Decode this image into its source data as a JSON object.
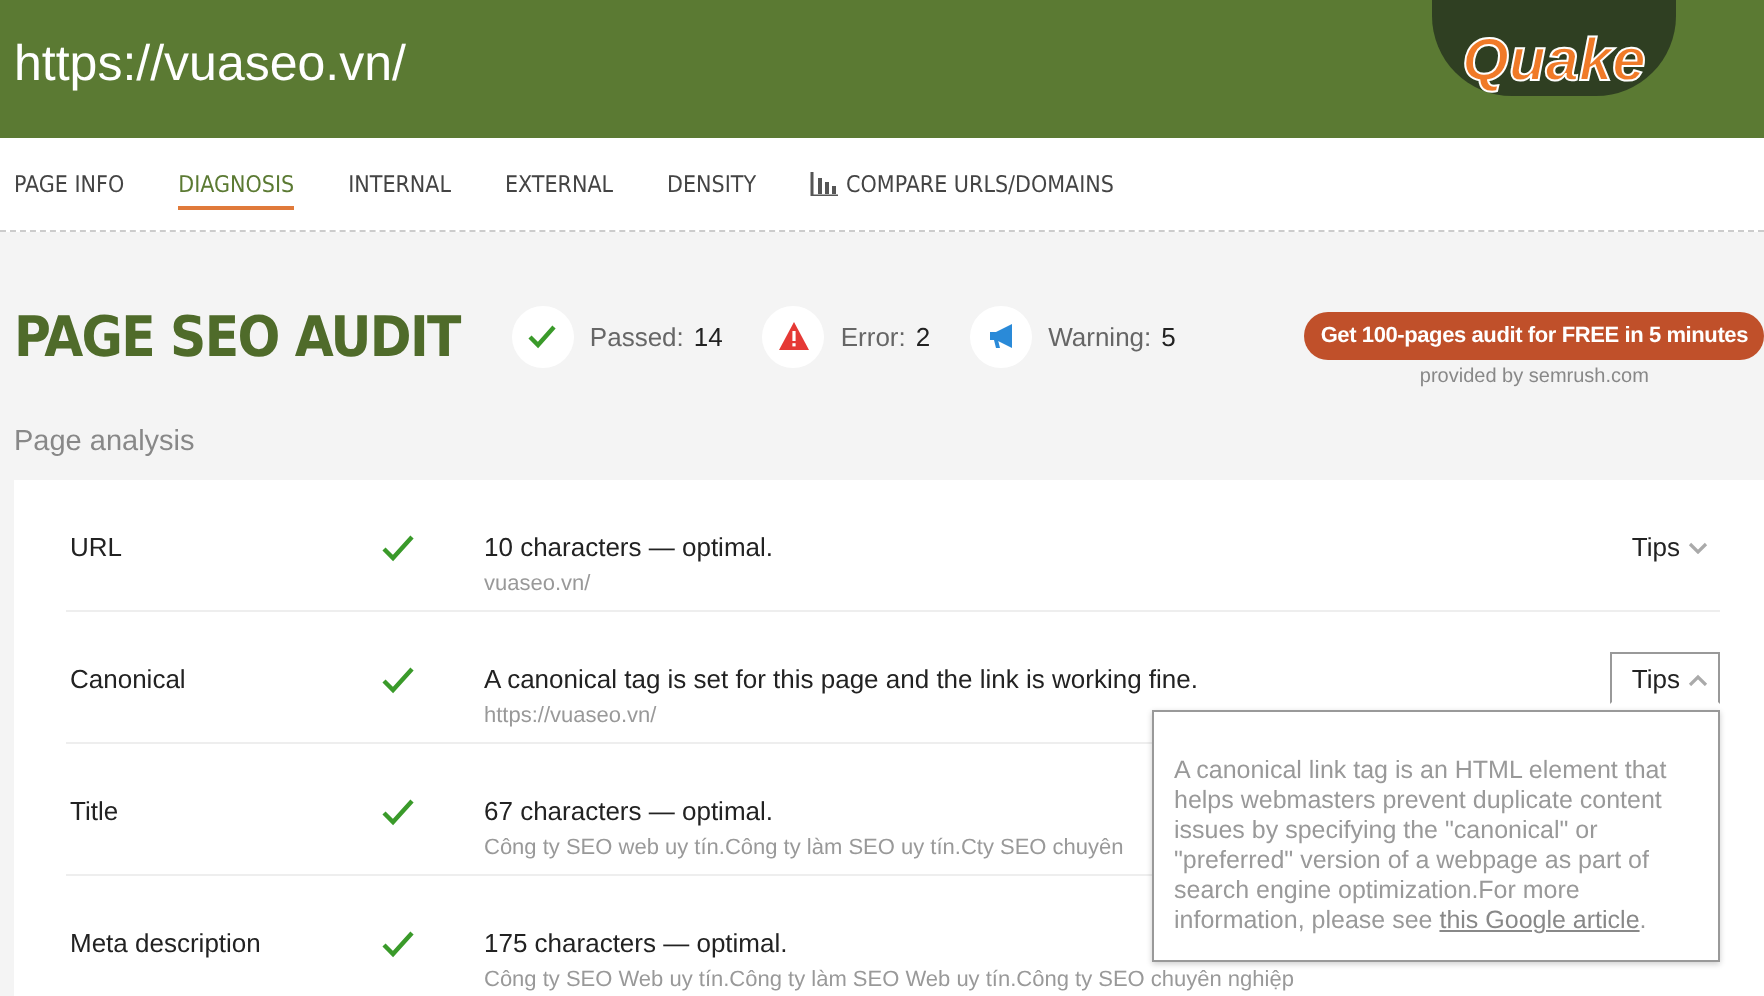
{
  "header": {
    "url": "https://vuaseo.vn/",
    "logo": "Quake"
  },
  "tabs": [
    {
      "label": "PAGE INFO",
      "selected": false,
      "icon": false
    },
    {
      "label": "DIAGNOSIS",
      "selected": true,
      "icon": false
    },
    {
      "label": "INTERNAL",
      "selected": false,
      "icon": false
    },
    {
      "label": "EXTERNAL",
      "selected": false,
      "icon": false
    },
    {
      "label": "DENSITY",
      "selected": false,
      "icon": false
    },
    {
      "label": "COMPARE URLS/DOMAINS",
      "selected": false,
      "icon": true
    }
  ],
  "audit": {
    "title": "PAGE SEO AUDIT",
    "stats": [
      {
        "kind": "passed",
        "label": "Passed:",
        "count": "14"
      },
      {
        "kind": "error",
        "label": "Error:",
        "count": "2"
      },
      {
        "kind": "warning",
        "label": "Warning:",
        "count": "5"
      }
    ],
    "promo_button": "Get 100-pages audit for FREE in 5 minutes",
    "provided_by": "provided by  semrush.com"
  },
  "section_title": "Page analysis",
  "rows": [
    {
      "name": "URL",
      "passed": true,
      "result": "10 characters — optimal.",
      "detail": "vuaseo.vn/",
      "tips": "Tips",
      "expanded": false
    },
    {
      "name": "Canonical",
      "passed": true,
      "result": "A canonical tag is set for this page and the link is working fine.",
      "detail": "https://vuaseo.vn/",
      "tips": "Tips",
      "expanded": true,
      "tip_text": "A canonical link tag is an HTML element that helps webmasters prevent duplicate content issues by specifying the \"canonical\" or \"preferred\" version of a webpage as part of search engine optimization.For more information, please see ",
      "tip_link": "this Google article",
      "tip_end": "."
    },
    {
      "name": "Title",
      "passed": true,
      "result": "67 characters — optimal.",
      "detail": "Công ty SEO web uy tín.Công ty làm SEO uy tín.Cty SEO chuyên"
    },
    {
      "name": "Meta description",
      "passed": true,
      "result": "175 characters — optimal.",
      "detail": "Công ty SEO Web uy tín.Công ty làm SEO Web uy tín.Công ty SEO chuyên nghiệp"
    }
  ]
}
